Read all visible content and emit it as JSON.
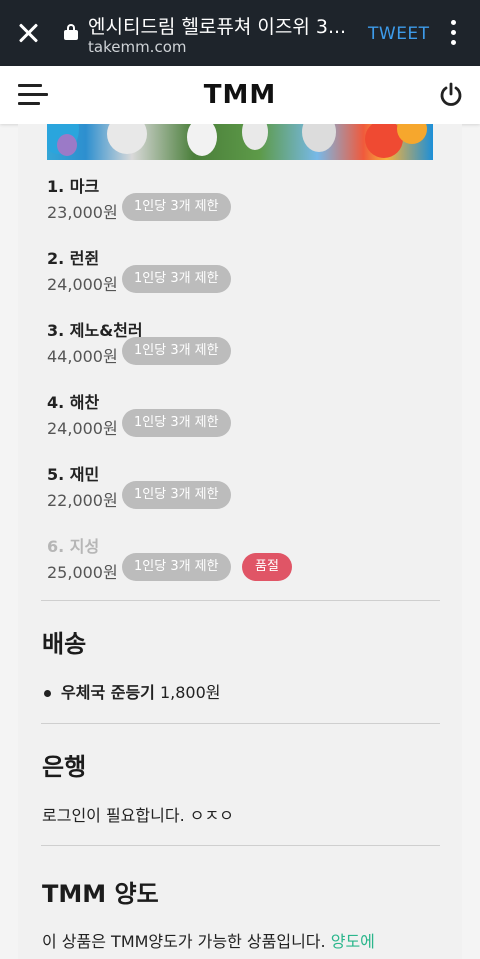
{
  "browser": {
    "title": "엔시티드림 헬로퓨쳐 이즈위 3...",
    "url": "takemm.com",
    "tweet_label": "TWEET"
  },
  "header": {
    "logo": "TMM"
  },
  "options": [
    {
      "name": "1. 마크",
      "price": "23,000원",
      "limit": "1인당 3개 제한"
    },
    {
      "name": "2. 런쥔",
      "price": "24,000원",
      "limit": "1인당 3개 제한"
    },
    {
      "name": "3. 제노&천러",
      "price": "44,000원",
      "limit": "1인당 3개 제한"
    },
    {
      "name": "4. 해찬",
      "price": "24,000원",
      "limit": "1인당 3개 제한"
    },
    {
      "name": "5. 재민",
      "price": "22,000원",
      "limit": "1인당 3개 제한"
    },
    {
      "name": "6. 지성",
      "price": "25,000원",
      "limit": "1인당 3개 제한",
      "status": "품절"
    }
  ],
  "shipping": {
    "title": "배송",
    "method": "우체국 준등기",
    "fee": "1,800원"
  },
  "bank": {
    "title": "은행",
    "text": "로그인이 필요합니다. ㅇㅈㅇ"
  },
  "transfer": {
    "title": "TMM 양도",
    "text": "이 상품은 TMM양도가 가능한 상품입니다.",
    "link": "양도에"
  },
  "colors": {
    "link": "#2bb68c",
    "soldout": "#e05566",
    "limit_badge": "#bcbcbc"
  }
}
